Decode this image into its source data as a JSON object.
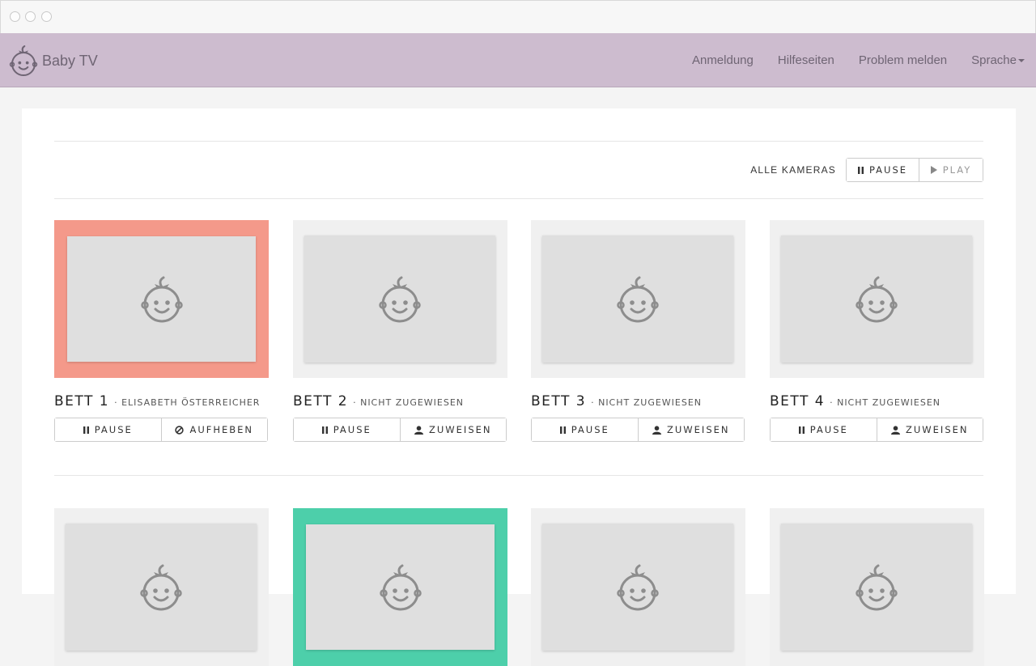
{
  "app": {
    "title": "Baby TV"
  },
  "nav": {
    "items": [
      "Anmeldung",
      "Hilfeseiten",
      "Problem melden",
      "Sprache"
    ]
  },
  "toolbar": {
    "label": "ALLE KAMERAS",
    "pause_label": "PAUSE",
    "play_label": "PLAY"
  },
  "cameras_row1": [
    {
      "name": "BETT 1",
      "status": "· ELISABETH ÖSTERREICHER",
      "highlight": "red",
      "btn1": "PAUSE",
      "btn2": "AUFHEBEN",
      "btn2_icon": "ban-icon"
    },
    {
      "name": "BETT 2",
      "status": "· NICHT ZUGEWIESEN",
      "highlight": "none",
      "btn1": "PAUSE",
      "btn2": "ZUWEISEN",
      "btn2_icon": "user-icon"
    },
    {
      "name": "BETT 3",
      "status": "· NICHT ZUGEWIESEN",
      "highlight": "none",
      "btn1": "PAUSE",
      "btn2": "ZUWEISEN",
      "btn2_icon": "user-icon"
    },
    {
      "name": "BETT 4",
      "status": "· NICHT ZUGEWIESEN",
      "highlight": "none",
      "btn1": "PAUSE",
      "btn2": "ZUWEISEN",
      "btn2_icon": "user-icon"
    }
  ],
  "cameras_row2": [
    {
      "highlight": "none"
    },
    {
      "highlight": "green"
    },
    {
      "highlight": "none"
    },
    {
      "highlight": "none"
    }
  ],
  "colors": {
    "navbar": "#cdbccf",
    "highlight_red": "#f4998a",
    "highlight_green": "#4dcfaa"
  }
}
